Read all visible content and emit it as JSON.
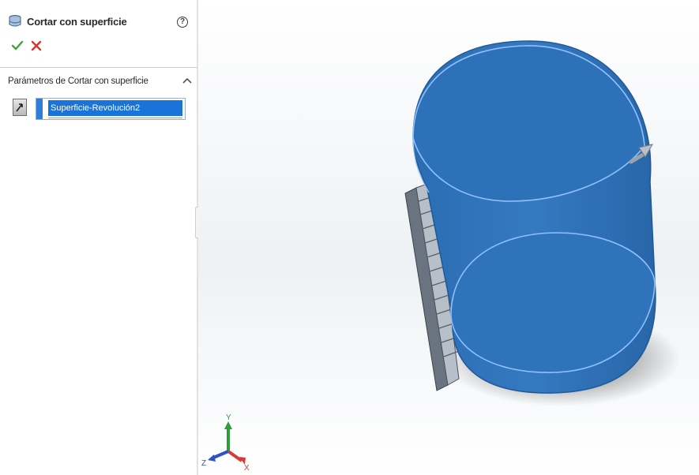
{
  "property_manager": {
    "title": "Cortar con superficie",
    "help_label": "?",
    "section_title": "Parámetros de Cortar con superficie",
    "selected_surface": "Superficie-Revolución2"
  },
  "graphics": {
    "triad_axes": {
      "x": "X",
      "y": "Y",
      "z": "Z"
    }
  },
  "colors": {
    "part_blue": "#2f73b8",
    "selection_blue": "#1a73d9",
    "ok_green": "#3aa63a",
    "cancel_red": "#d9342b"
  }
}
